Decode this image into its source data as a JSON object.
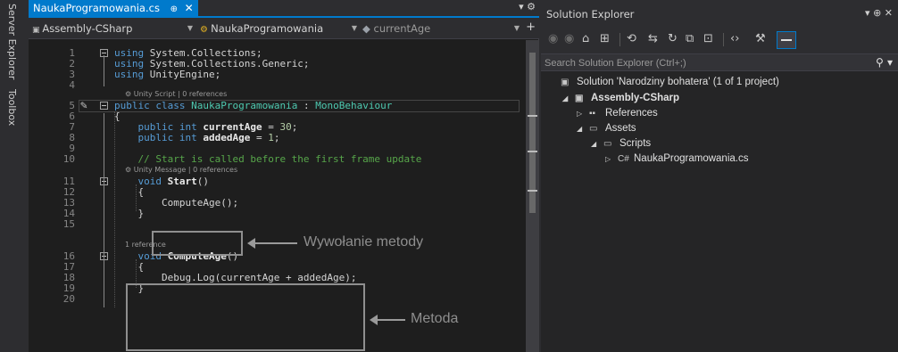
{
  "left_strip": {
    "tabs": [
      "Server Explorer",
      "Toolbox"
    ]
  },
  "editor": {
    "tab": {
      "title": "NaukaProgramowania.cs",
      "pin": "⊕",
      "close": "✕"
    },
    "tabbar_icons": "▾ ⚙",
    "nav": {
      "project": "Assembly-CSharp",
      "class": "NaukaProgramowania",
      "member": "currentAge",
      "split": "+"
    },
    "lines": [
      {
        "n": "1",
        "parts": [
          {
            "t": "using",
            "c": "kw"
          },
          {
            "t": " System.Collections;"
          }
        ]
      },
      {
        "n": "2",
        "parts": [
          {
            "t": "using",
            "c": "kw"
          },
          {
            "t": " System.Collections.Generic;"
          }
        ]
      },
      {
        "n": "3",
        "parts": [
          {
            "t": "using",
            "c": "kw"
          },
          {
            "t": " UnityEngine;"
          }
        ]
      },
      {
        "n": "4",
        "parts": []
      },
      {
        "n": "5",
        "lens": "⚙ Unity Script | 0 references",
        "parts": [
          {
            "t": "public",
            "c": "kw"
          },
          {
            "t": " "
          },
          {
            "t": "class",
            "c": "kw"
          },
          {
            "t": " "
          },
          {
            "t": "NaukaProgramowania",
            "c": "ty"
          },
          {
            "t": " : "
          },
          {
            "t": "MonoBehaviour",
            "c": "ty"
          }
        ]
      },
      {
        "n": "6",
        "parts": [
          {
            "t": "{"
          }
        ]
      },
      {
        "n": "7",
        "parts": [
          {
            "t": "    "
          },
          {
            "t": "public",
            "c": "kw"
          },
          {
            "t": " "
          },
          {
            "t": "int",
            "c": "kw"
          },
          {
            "t": " "
          },
          {
            "t": "currentAge",
            "c": "bold"
          },
          {
            "t": " = "
          },
          {
            "t": "30",
            "c": "num"
          },
          {
            "t": ";"
          }
        ]
      },
      {
        "n": "8",
        "parts": [
          {
            "t": "    "
          },
          {
            "t": "public",
            "c": "kw"
          },
          {
            "t": " "
          },
          {
            "t": "int",
            "c": "kw"
          },
          {
            "t": " "
          },
          {
            "t": "addedAge",
            "c": "bold"
          },
          {
            "t": " = "
          },
          {
            "t": "1",
            "c": "num"
          },
          {
            "t": ";"
          }
        ]
      },
      {
        "n": "9",
        "parts": []
      },
      {
        "n": "10",
        "parts": [
          {
            "t": "    "
          },
          {
            "t": "// Start is called before the first frame update",
            "c": "cm"
          }
        ]
      },
      {
        "n": "11",
        "lens": "⚙ Unity Message | 0 references",
        "parts": [
          {
            "t": "    "
          },
          {
            "t": "void",
            "c": "kw"
          },
          {
            "t": " "
          },
          {
            "t": "Start",
            "c": "bold"
          },
          {
            "t": "()"
          }
        ]
      },
      {
        "n": "12",
        "parts": [
          {
            "t": "    {"
          }
        ]
      },
      {
        "n": "13",
        "parts": [
          {
            "t": "        ComputeAge();"
          }
        ]
      },
      {
        "n": "14",
        "parts": [
          {
            "t": "    }"
          }
        ]
      },
      {
        "n": "15",
        "parts": []
      },
      {
        "n": "16",
        "lens": "1 reference",
        "parts": [
          {
            "t": "    "
          },
          {
            "t": "void",
            "c": "kw"
          },
          {
            "t": " "
          },
          {
            "t": "ComputeAge",
            "c": "bold"
          },
          {
            "t": "()"
          }
        ]
      },
      {
        "n": "17",
        "parts": [
          {
            "t": "    {"
          }
        ]
      },
      {
        "n": "18",
        "parts": [
          {
            "t": "        Debug.Log(currentAge + addedAge);"
          }
        ]
      },
      {
        "n": "19",
        "parts": [
          {
            "t": "    }"
          }
        ]
      },
      {
        "n": "20",
        "parts": []
      }
    ],
    "callouts": {
      "call": "Wywołanie metody",
      "method": "Metoda"
    }
  },
  "solution_explorer": {
    "title": "Solution Explorer",
    "title_controls": "▾ ⊕ ✕",
    "toolbar": [
      "◉",
      "◉",
      "⌂",
      "⊞",
      "⟲",
      "⇆",
      "↻",
      "⧉",
      "⊡",
      "‹›",
      "⚒"
    ],
    "search_placeholder": "Search Solution Explorer (Ctrl+;)",
    "search_icon": "⚲ ▾",
    "tree": [
      {
        "label": "Solution 'Narodziny bohatera' (1 of 1 project)",
        "exp": "",
        "icon": "▣",
        "indent": 0
      },
      {
        "label": "Assembly-CSharp",
        "exp": "◢",
        "icon": "▣",
        "indent": 1,
        "bold": true
      },
      {
        "label": "References",
        "exp": "▷",
        "icon": "▪▪",
        "indent": 2
      },
      {
        "label": "Assets",
        "exp": "◢",
        "icon": "▭",
        "indent": 2
      },
      {
        "label": "Scripts",
        "exp": "◢",
        "icon": "▭",
        "indent": 3
      },
      {
        "label": "NaukaProgramowania.cs",
        "exp": "▷",
        "icon": "C#",
        "indent": 4
      }
    ]
  },
  "colors": {
    "accent": "#007acc",
    "editor_bg": "#1e1e1e",
    "keyword": "#569cd6",
    "type": "#4ec9b0",
    "comment": "#57a64a",
    "number": "#b5cea8"
  }
}
